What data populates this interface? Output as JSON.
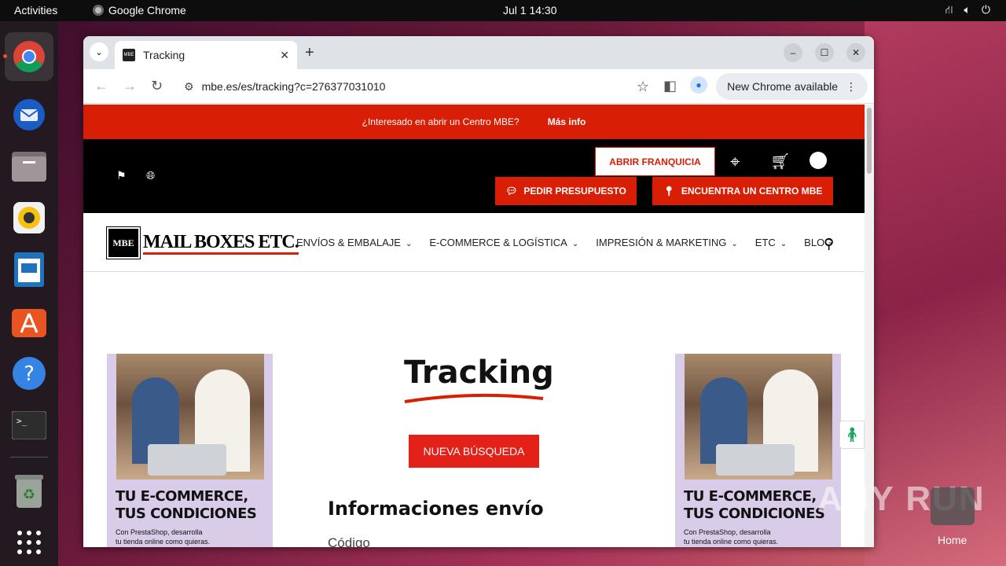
{
  "topbar": {
    "activities": "Activities",
    "app_name": "Google Chrome",
    "clock": "Jul 1  14:30"
  },
  "dock": {
    "items": [
      "chrome-icon",
      "thunderbird-icon",
      "files-icon",
      "rhythmbox-icon",
      "writer-icon",
      "app-center-icon",
      "help-icon",
      "terminal-icon",
      "trash-icon",
      "app-grid-icon"
    ]
  },
  "browser": {
    "tab_title": "Tracking",
    "tab_favicon_text": "MBE",
    "url": "mbe.es/es/tracking?c=276377031010",
    "new_chrome": "New Chrome available"
  },
  "site": {
    "banner_text": "¿Interesado en abrir un Centro MBE?",
    "banner_link": "Más info",
    "franquicia": "ABRIR FRANQUICIA",
    "presupuesto": "PEDIR PRESUPUESTO",
    "centro": "ENCUENTRA UN CENTRO MBE",
    "logo_box": "MBE",
    "logo_text": "MAIL BOXES ETC.",
    "menu": [
      "ENVÍOS & EMBALAJE",
      "E-COMMERCE & LOGÍSTICA",
      "IMPRESIÓN & MARKETING",
      "ETC",
      "BLOG"
    ],
    "page_title": "Tracking",
    "nueva_busqueda": "NUEVA BÚSQUEDA",
    "info_heading": "Informaciones envío",
    "codigo_label": "Código"
  },
  "ad": {
    "line1": "TU E-COMMERCE,",
    "line2": "TUS CONDICIONES",
    "sub1": "Con PrestaShop, desarrolla",
    "sub2": "tu tienda online como quieras."
  },
  "desktop": {
    "watermark": "ANY RUN",
    "home_label": "Home"
  },
  "colors": {
    "brand_red": "#d81e05",
    "button_red": "#e32119"
  }
}
